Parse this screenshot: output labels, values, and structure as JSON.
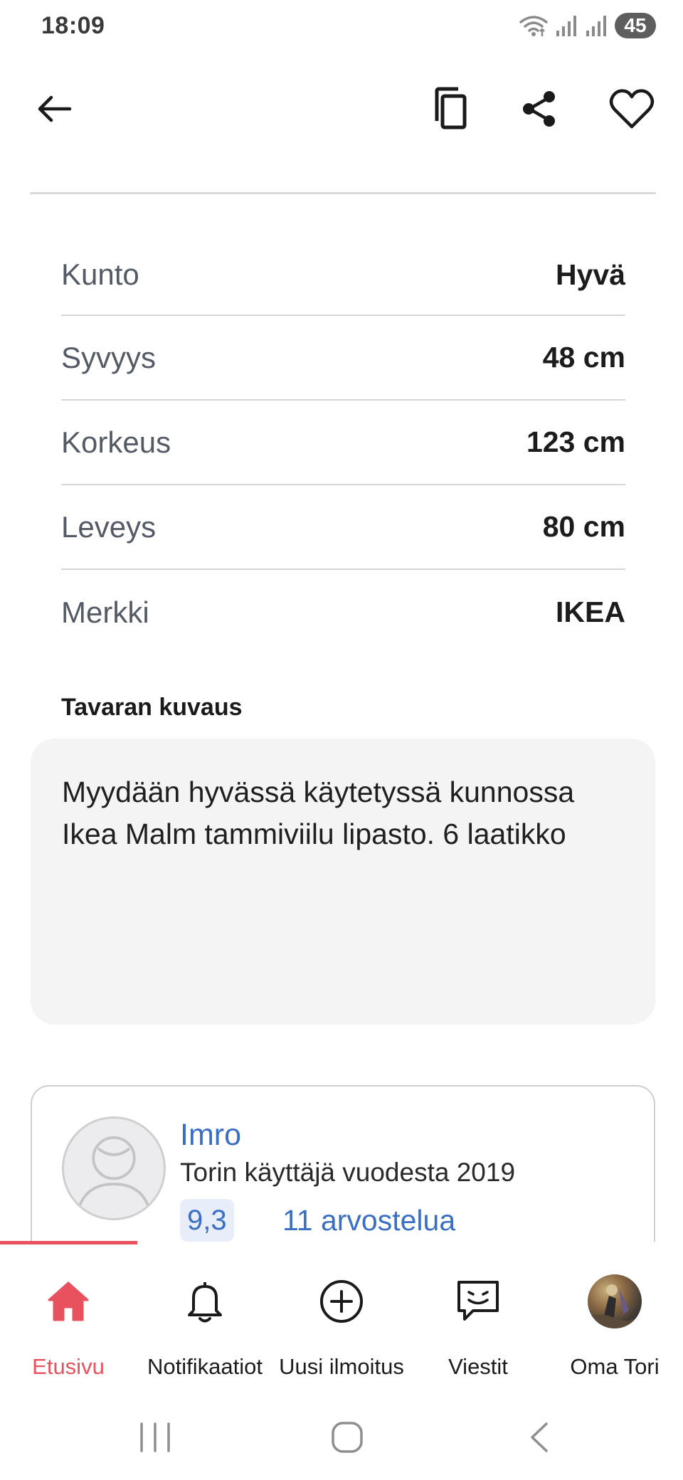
{
  "status_bar": {
    "time": "18:09",
    "battery": "45",
    "icons": [
      "wifi-icon",
      "signal-icon",
      "signal-icon",
      "battery-icon"
    ]
  },
  "app_bar": {
    "icons": [
      "back-arrow-icon",
      "copy-icon",
      "share-icon",
      "heart-icon"
    ]
  },
  "details": {
    "rows": [
      {
        "label": "Kunto",
        "value": "Hyvä"
      },
      {
        "label": "Syvyys",
        "value": "48 cm"
      },
      {
        "label": "Korkeus",
        "value": "123 cm"
      },
      {
        "label": "Leveys",
        "value": "80 cm"
      },
      {
        "label": "Merkki",
        "value": "IKEA"
      }
    ]
  },
  "description": {
    "title": "Tavaran kuvaus",
    "line1": "Myydään hyvässä käytetyssä kunnossa",
    "line2": "Ikea Malm tammiviilu lipasto. 6 laatikko"
  },
  "seller": {
    "name": "Imro",
    "since": "Torin käyttäjä vuodesta 2019",
    "rating": "9,3",
    "reviews": "11 arvostelua"
  },
  "bottom_nav": {
    "items": [
      {
        "label": "Etusivu",
        "icon": "home-icon",
        "active": true
      },
      {
        "label": "Notifikaatiot",
        "icon": "bell-icon",
        "active": false
      },
      {
        "label": "Uusi ilmoitus",
        "icon": "plus-circle-icon",
        "active": false
      },
      {
        "label": "Viestit",
        "icon": "chat-icon",
        "active": false
      },
      {
        "label": "Oma Tori",
        "icon": "profile-avatar",
        "active": false
      }
    ]
  },
  "colors": {
    "accent": "#e8525f",
    "link": "#3a6fc4",
    "muted_label": "#555b64",
    "desc_bg": "#f4f4f5"
  }
}
